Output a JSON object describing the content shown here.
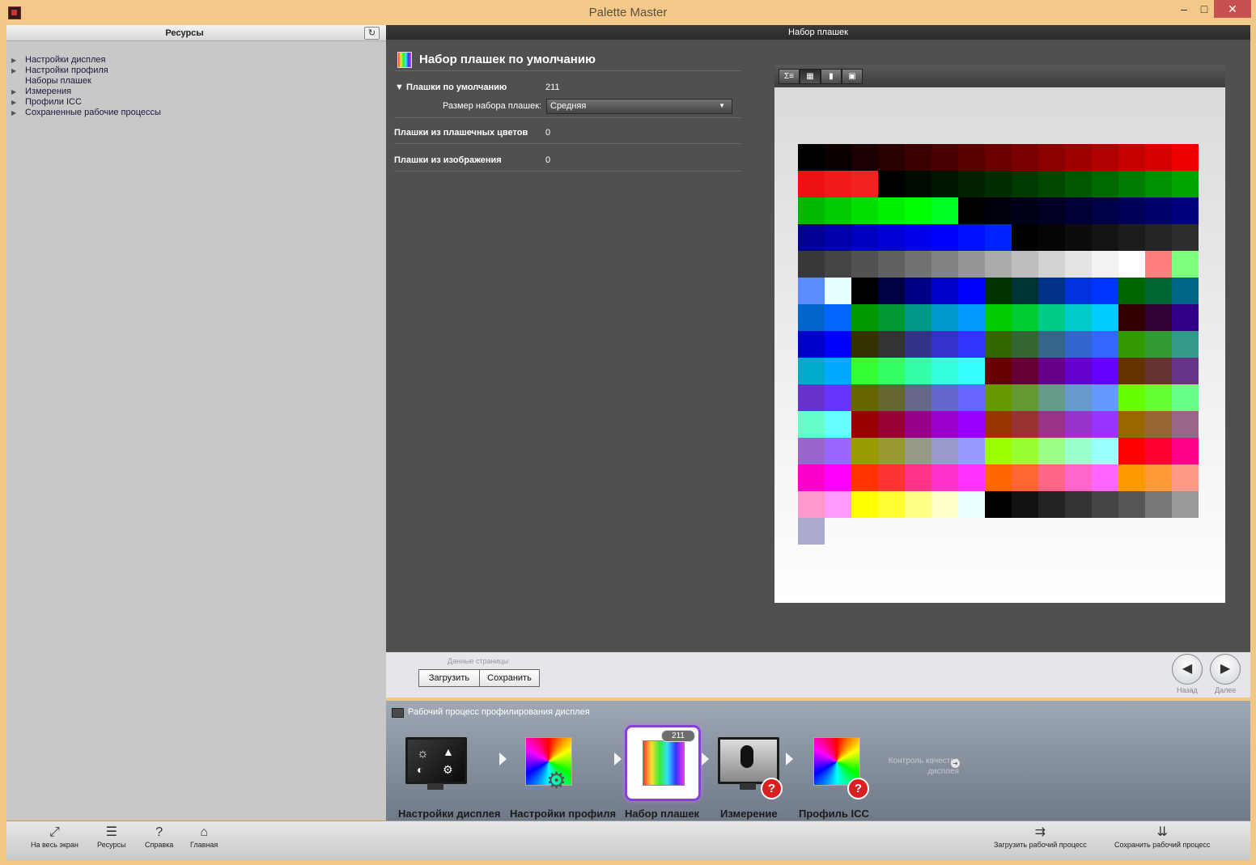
{
  "window": {
    "title": "Palette Master"
  },
  "left_panel": {
    "title": "Ресурсы",
    "tree": [
      "Настройки дисплея",
      "Настройки профиля",
      "Наборы плашек",
      "Измерения",
      "Профили ICC",
      "Сохраненные рабочие процессы"
    ]
  },
  "main": {
    "header": "Набор плашек",
    "section_title": "Набор плашек по умолчанию",
    "default_patches_label": "Плашки по умолчанию",
    "default_patches_value": "211",
    "set_size_label": "Размер набора плашек:",
    "set_size_value": "Средняя",
    "spot_patches_label": "Плашки из плашечных цветов",
    "spot_patches_value": "0",
    "image_patches_label": "Плашки из изображения",
    "image_patches_value": "0"
  },
  "preview_toolbar": {
    "icons": [
      "sum-icon",
      "grid-view-icon",
      "info-icon",
      "image-view-icon"
    ],
    "btn_sum": "Σ≡"
  },
  "patches": [
    "#000000",
    "#0b0000",
    "#1a0000",
    "#2a0000",
    "#3a0000",
    "#4a0000",
    "#5a0000",
    "#6a0000",
    "#7a0000",
    "#8c0000",
    "#9e0000",
    "#b00000",
    "#c40000",
    "#d80000",
    "#ec0000",
    "#ee1111",
    "#f01a1a",
    "#f22222",
    "#000000",
    "#000b00",
    "#001600",
    "#002200",
    "#002e00",
    "#003a00",
    "#004800",
    "#005800",
    "#006a00",
    "#007d00",
    "#009000",
    "#00a400",
    "#00b800",
    "#00cc00",
    "#00e000",
    "#00f000",
    "#00ff00",
    "#00ff22",
    "#000000",
    "#00000c",
    "#000018",
    "#000026",
    "#000036",
    "#000046",
    "#000058",
    "#00006a",
    "#00007e",
    "#000094",
    "#0000aa",
    "#0000c0",
    "#0000d6",
    "#0000ea",
    "#0000ff",
    "#0011ff",
    "#0022ff",
    "#000000",
    "#050505",
    "#0c0c0c",
    "#141414",
    "#1c1c1c",
    "#242424",
    "#2e2e2e",
    "#383838",
    "#444444",
    "#525252",
    "#616161",
    "#727272",
    "#838383",
    "#969696",
    "#aaaaaa",
    "#bebebe",
    "#d2d2d2",
    "#e4e4e4",
    "#f2f2f2",
    "#ffffff",
    "#ff7f7f",
    "#7fff7f",
    "#5a8cff",
    "#e6ffff",
    "#000000",
    "#000044",
    "#000088",
    "#0000cc",
    "#0000ff",
    "#003300",
    "#003333",
    "#003388",
    "#0033dd",
    "#0033ff",
    "#006600",
    "#006633",
    "#006688",
    "#0066cc",
    "#0066ff",
    "#009900",
    "#009933",
    "#009988",
    "#0099cc",
    "#0099ff",
    "#00cc00",
    "#00cc33",
    "#00cc88",
    "#00cccc",
    "#00ccff",
    "#330000",
    "#330033",
    "#330088",
    "#0000cc",
    "#0000ff",
    "#333300",
    "#333333",
    "#333388",
    "#3333cc",
    "#3333ff",
    "#336600",
    "#336633",
    "#336688",
    "#3366cc",
    "#3366ff",
    "#339900",
    "#339933",
    "#339988",
    "#00aacc",
    "#00aaff",
    "#33ff33",
    "#33ff66",
    "#33ffaa",
    "#33ffdd",
    "#33ffff",
    "#660000",
    "#660033",
    "#660088",
    "#6600cc",
    "#6600ff",
    "#663300",
    "#663333",
    "#663388",
    "#6633cc",
    "#6633ff",
    "#666600",
    "#666633",
    "#666688",
    "#6666cc",
    "#6666ff",
    "#669900",
    "#669933",
    "#669988",
    "#6699cc",
    "#6699ff",
    "#66ff00",
    "#66ff33",
    "#66ff88",
    "#66ffcc",
    "#66ffff",
    "#990000",
    "#990033",
    "#990088",
    "#9900cc",
    "#9900ff",
    "#993300",
    "#993333",
    "#993388",
    "#9933cc",
    "#9933ff",
    "#996600",
    "#996633",
    "#996688",
    "#9966cc",
    "#9966ff",
    "#999900",
    "#999933",
    "#999988",
    "#9999cc",
    "#9999ff",
    "#99ff00",
    "#99ff33",
    "#99ff88",
    "#99ffcc",
    "#99ffff",
    "#ff0000",
    "#ff0033",
    "#ff0088",
    "#ff00cc",
    "#ff00ff",
    "#ff3300",
    "#ff3333",
    "#ff3388",
    "#ff33cc",
    "#ff33ff",
    "#ff6600",
    "#ff6633",
    "#ff6688",
    "#ff66cc",
    "#ff66ff",
    "#ff9900",
    "#ff9933",
    "#ff9988",
    "#ff99cc",
    "#ff99ff",
    "#ffff00",
    "#ffff33",
    "#ffff88",
    "#ffffcc",
    "#eaffff",
    "#000000",
    "#111111",
    "#222222",
    "#333333",
    "#444444",
    "#555555",
    "#777777",
    "#999999",
    "#aaaacc"
  ],
  "page_data": {
    "label": "Данные страницы",
    "load": "Загрузить",
    "save": "Сохранить",
    "back": "Назад",
    "next": "Далее"
  },
  "workflow": {
    "title": "Рабочий процесс профилирования дисплея",
    "steps": [
      {
        "label": "Настройки дисплея"
      },
      {
        "label": "Настройки профиля"
      },
      {
        "label": "Набор плашек",
        "badge": "211"
      },
      {
        "label": "Измерение"
      },
      {
        "label": "Профиль ICC"
      }
    ],
    "quality_check": "Контроль качества дисплея",
    "active_color": "#8a3ee0"
  },
  "bottom_toolbar": {
    "fullscreen": "На весь экран",
    "resources": "Ресурсы",
    "help": "Справка",
    "home": "Главная",
    "load_workflow": "Загрузить рабочий процесс",
    "save_workflow": "Сохранить рабочий процесс"
  }
}
